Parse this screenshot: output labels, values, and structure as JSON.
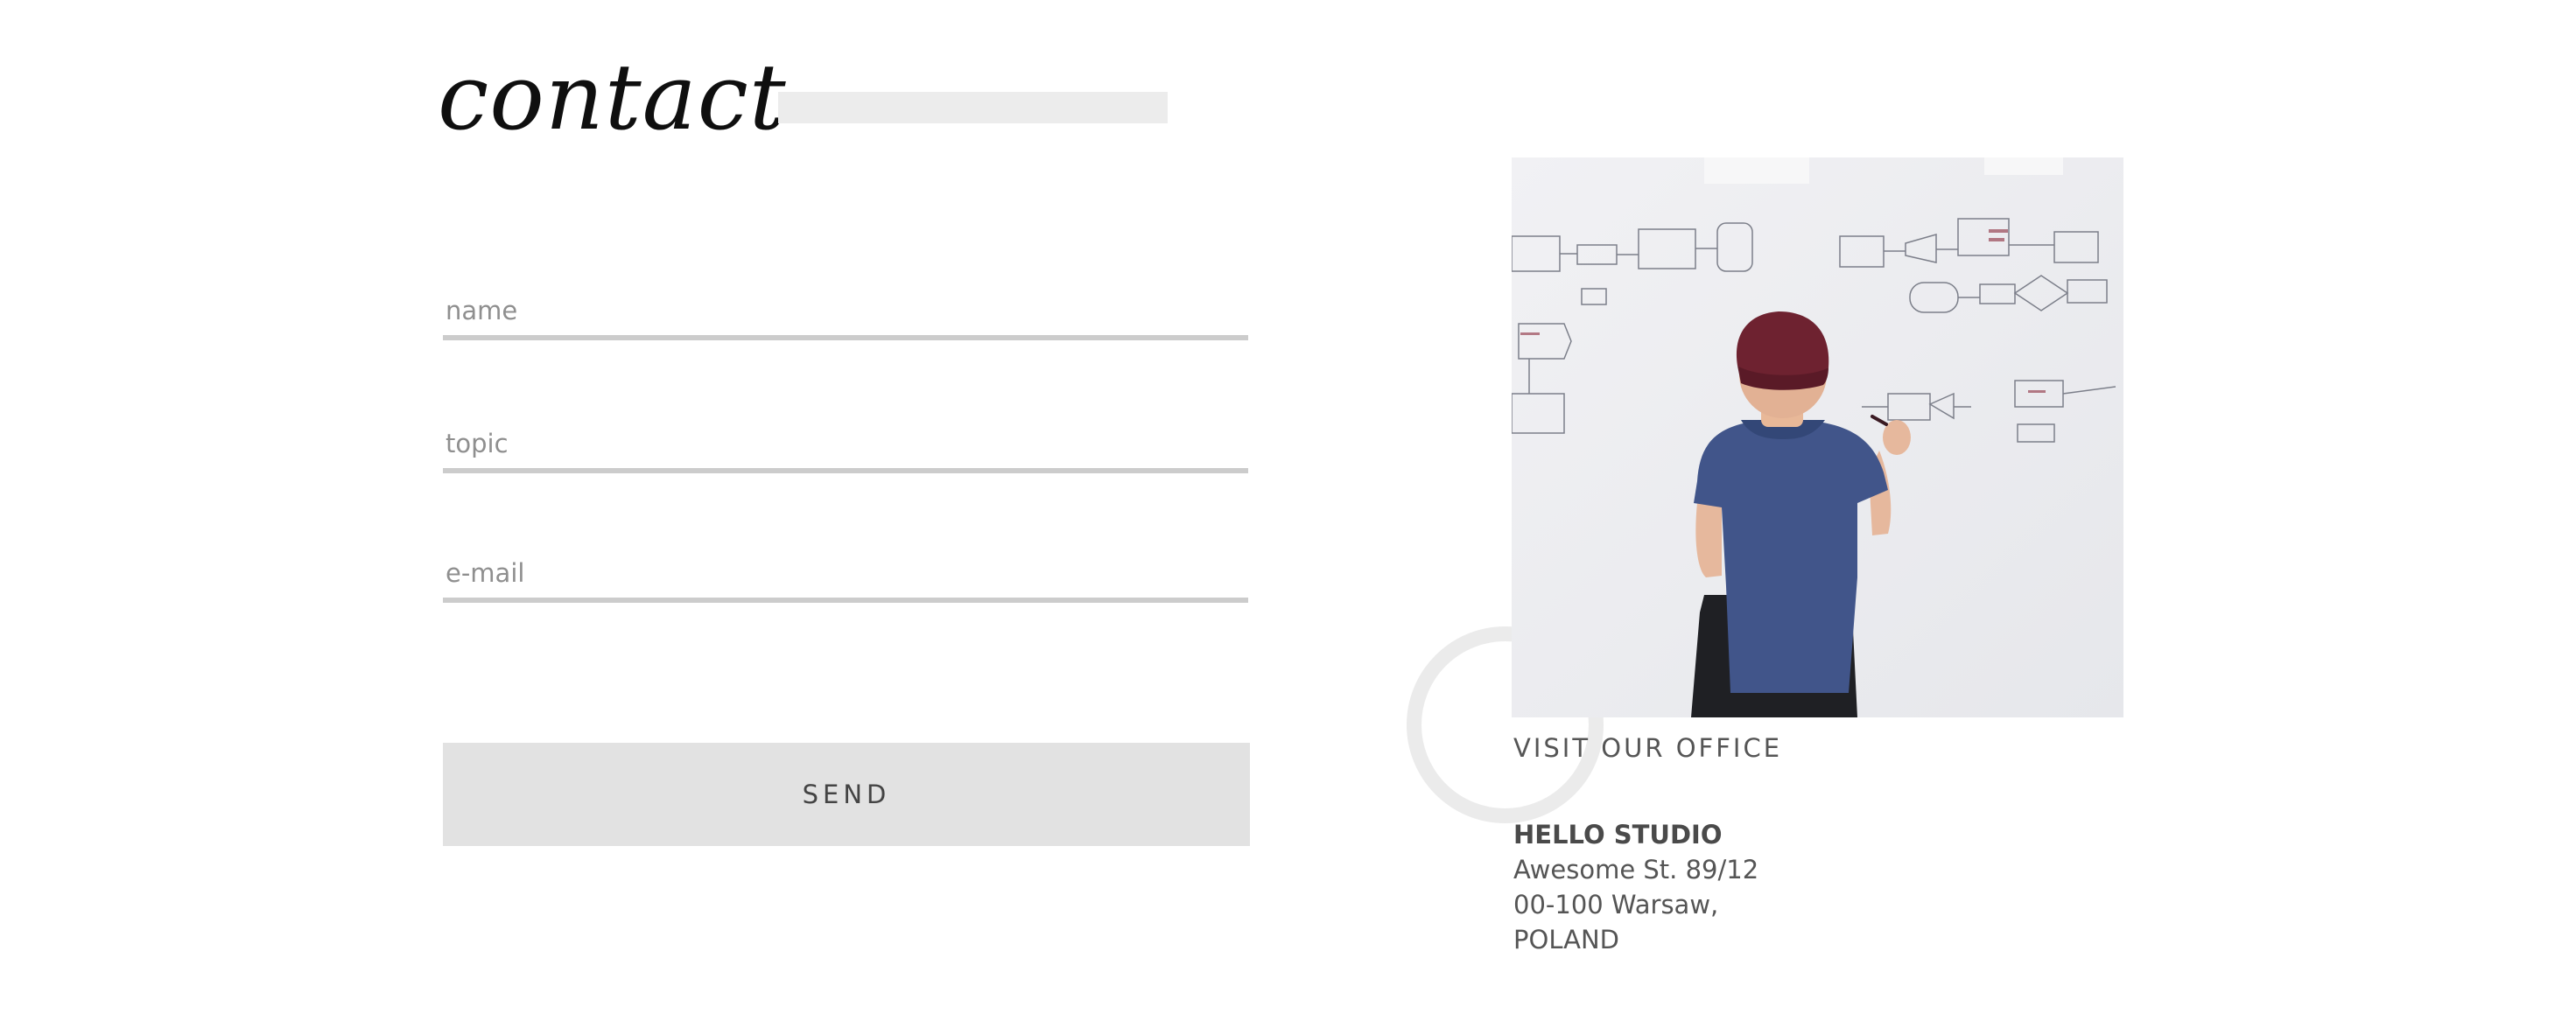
{
  "contact": {
    "title": "contact"
  },
  "form": {
    "name_placeholder": "name",
    "topic_placeholder": "topic",
    "email_placeholder": "e-mail",
    "send_label": "SEND"
  },
  "office": {
    "caption": "VISIT OUR OFFICE",
    "studio_name": "HELLO STUDIO",
    "street": "Awesome St. 89/12",
    "city": "00-100 Warsaw,",
    "country": "POLAND"
  },
  "colors": {
    "accent_gray": "#e2e2e2",
    "field_line": "#cccccc",
    "text": "#444444"
  }
}
